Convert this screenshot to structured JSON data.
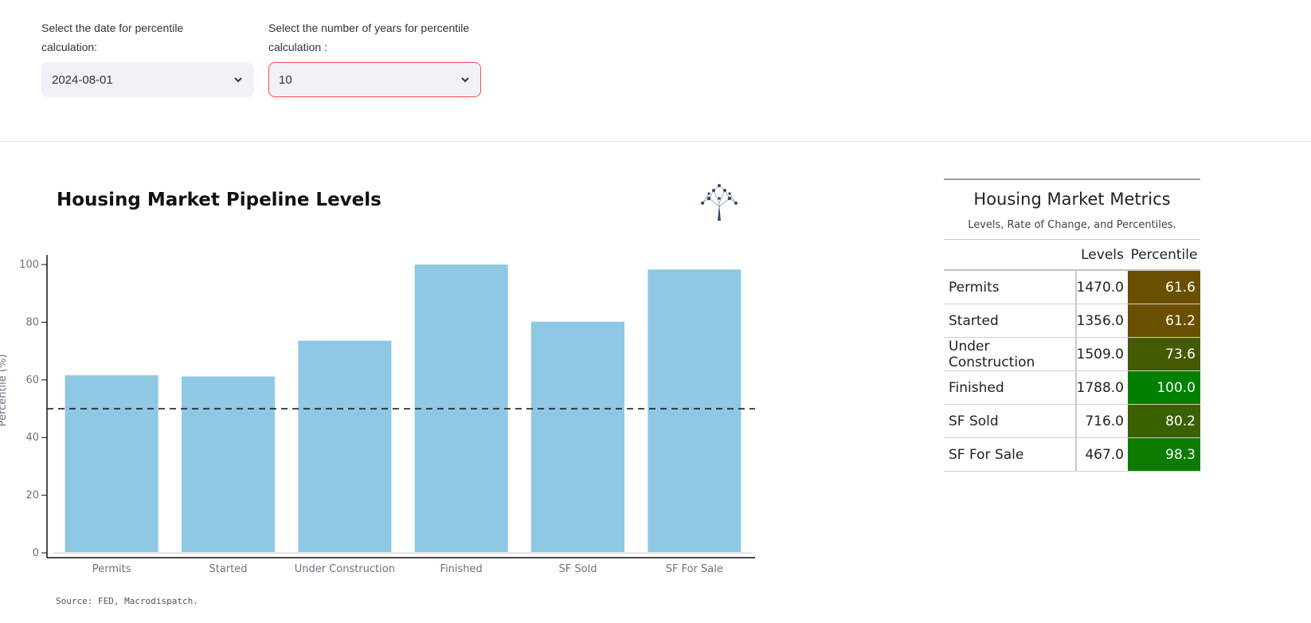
{
  "controls": {
    "date_label": "Select the date for percentile calculation:",
    "date_value": "2024-08-01",
    "years_label": "Select the number of years for percentile calculation :",
    "years_value": "10"
  },
  "chart": {
    "title": "Housing Market Pipeline Levels",
    "source": "Source: FED, Macrodispatch."
  },
  "chart_data": {
    "type": "bar",
    "categories": [
      "Permits",
      "Started",
      "Under Construction",
      "Finished",
      "SF Sold",
      "SF For Sale"
    ],
    "values": [
      61.6,
      61.2,
      73.6,
      100.0,
      80.2,
      98.3
    ],
    "ylabel": "Percentile (%)",
    "ylim": [
      0,
      105
    ],
    "yticks": [
      0,
      20,
      40,
      60,
      80,
      100
    ],
    "reference_line": 50,
    "bar_color": "#8fc8e4",
    "grid": false
  },
  "table": {
    "title": "Housing Market Metrics",
    "subtitle": "Levels, Rate of Change, and Percentiles.",
    "headers": [
      "",
      "Levels",
      "Percentile"
    ],
    "rows": [
      {
        "name": "Permits",
        "level": "1470.0",
        "pct": "61.6",
        "color": "#6b4f00"
      },
      {
        "name": "Started",
        "level": "1356.0",
        "pct": "61.2",
        "color": "#6b4f00"
      },
      {
        "name": "Under Construction",
        "level": "1509.0",
        "pct": "73.6",
        "color": "#435a00"
      },
      {
        "name": "Finished",
        "level": "1788.0",
        "pct": "100.0",
        "color": "#008000"
      },
      {
        "name": "SF Sold",
        "level": "716.0",
        "pct": "80.2",
        "color": "#3a6100"
      },
      {
        "name": "SF For Sale",
        "level": "467.0",
        "pct": "98.3",
        "color": "#0a7d00"
      }
    ]
  }
}
